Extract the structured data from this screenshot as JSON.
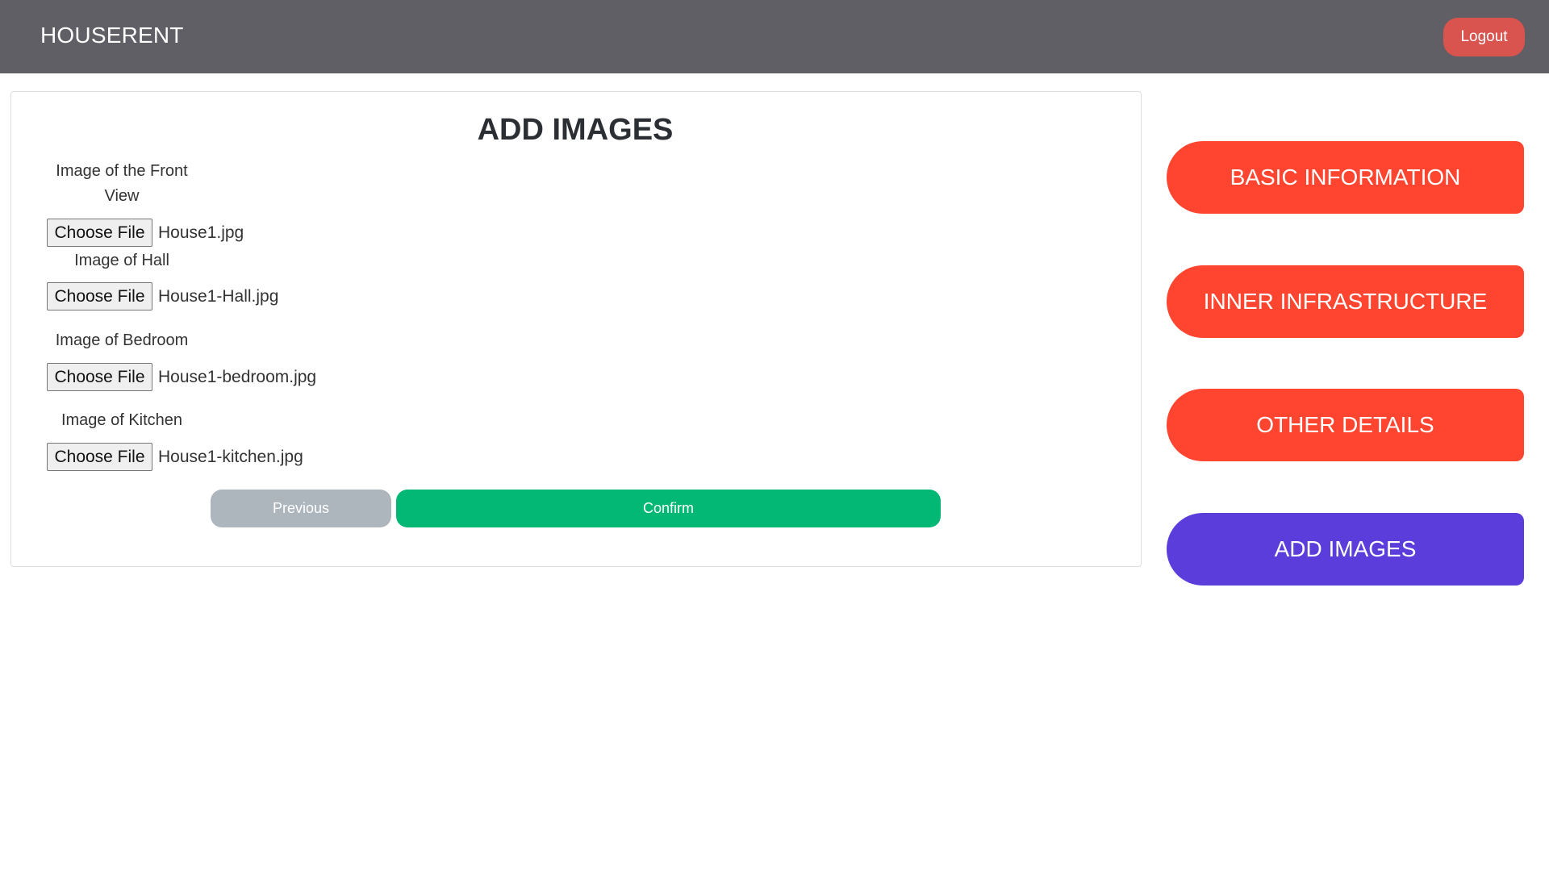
{
  "header": {
    "brand": "HOUSERENT",
    "logout_label": "Logout"
  },
  "form": {
    "title": "ADD IMAGES",
    "fields": [
      {
        "label_line1": "Image of the Front",
        "label_line2": "View",
        "button_label": "Choose File",
        "file_name": "House1.jpg"
      },
      {
        "label_line1": "Image of Hall",
        "button_label": "Choose File",
        "file_name": "House1-Hall.jpg"
      },
      {
        "label_line1": "Image of Bedroom",
        "button_label": "Choose File",
        "file_name": "House1-bedroom.jpg"
      },
      {
        "label_line1": "Image of Kitchen",
        "button_label": "Choose File",
        "file_name": "House1-kitchen.jpg"
      }
    ],
    "previous_label": "Previous",
    "confirm_label": "Confirm"
  },
  "steps": [
    {
      "label": "BASIC INFORMATION",
      "active": false
    },
    {
      "label": "INNER INFRASTRUCTURE",
      "active": false
    },
    {
      "label": "OTHER DETAILS",
      "active": false
    },
    {
      "label": "ADD IMAGES",
      "active": true
    }
  ],
  "colors": {
    "header_bg": "#5f5f65",
    "logout": "#d9534f",
    "step_inactive": "#ff4530",
    "step_active": "#5b3ddb",
    "confirm": "#03b775",
    "previous": "#adb5bd"
  }
}
